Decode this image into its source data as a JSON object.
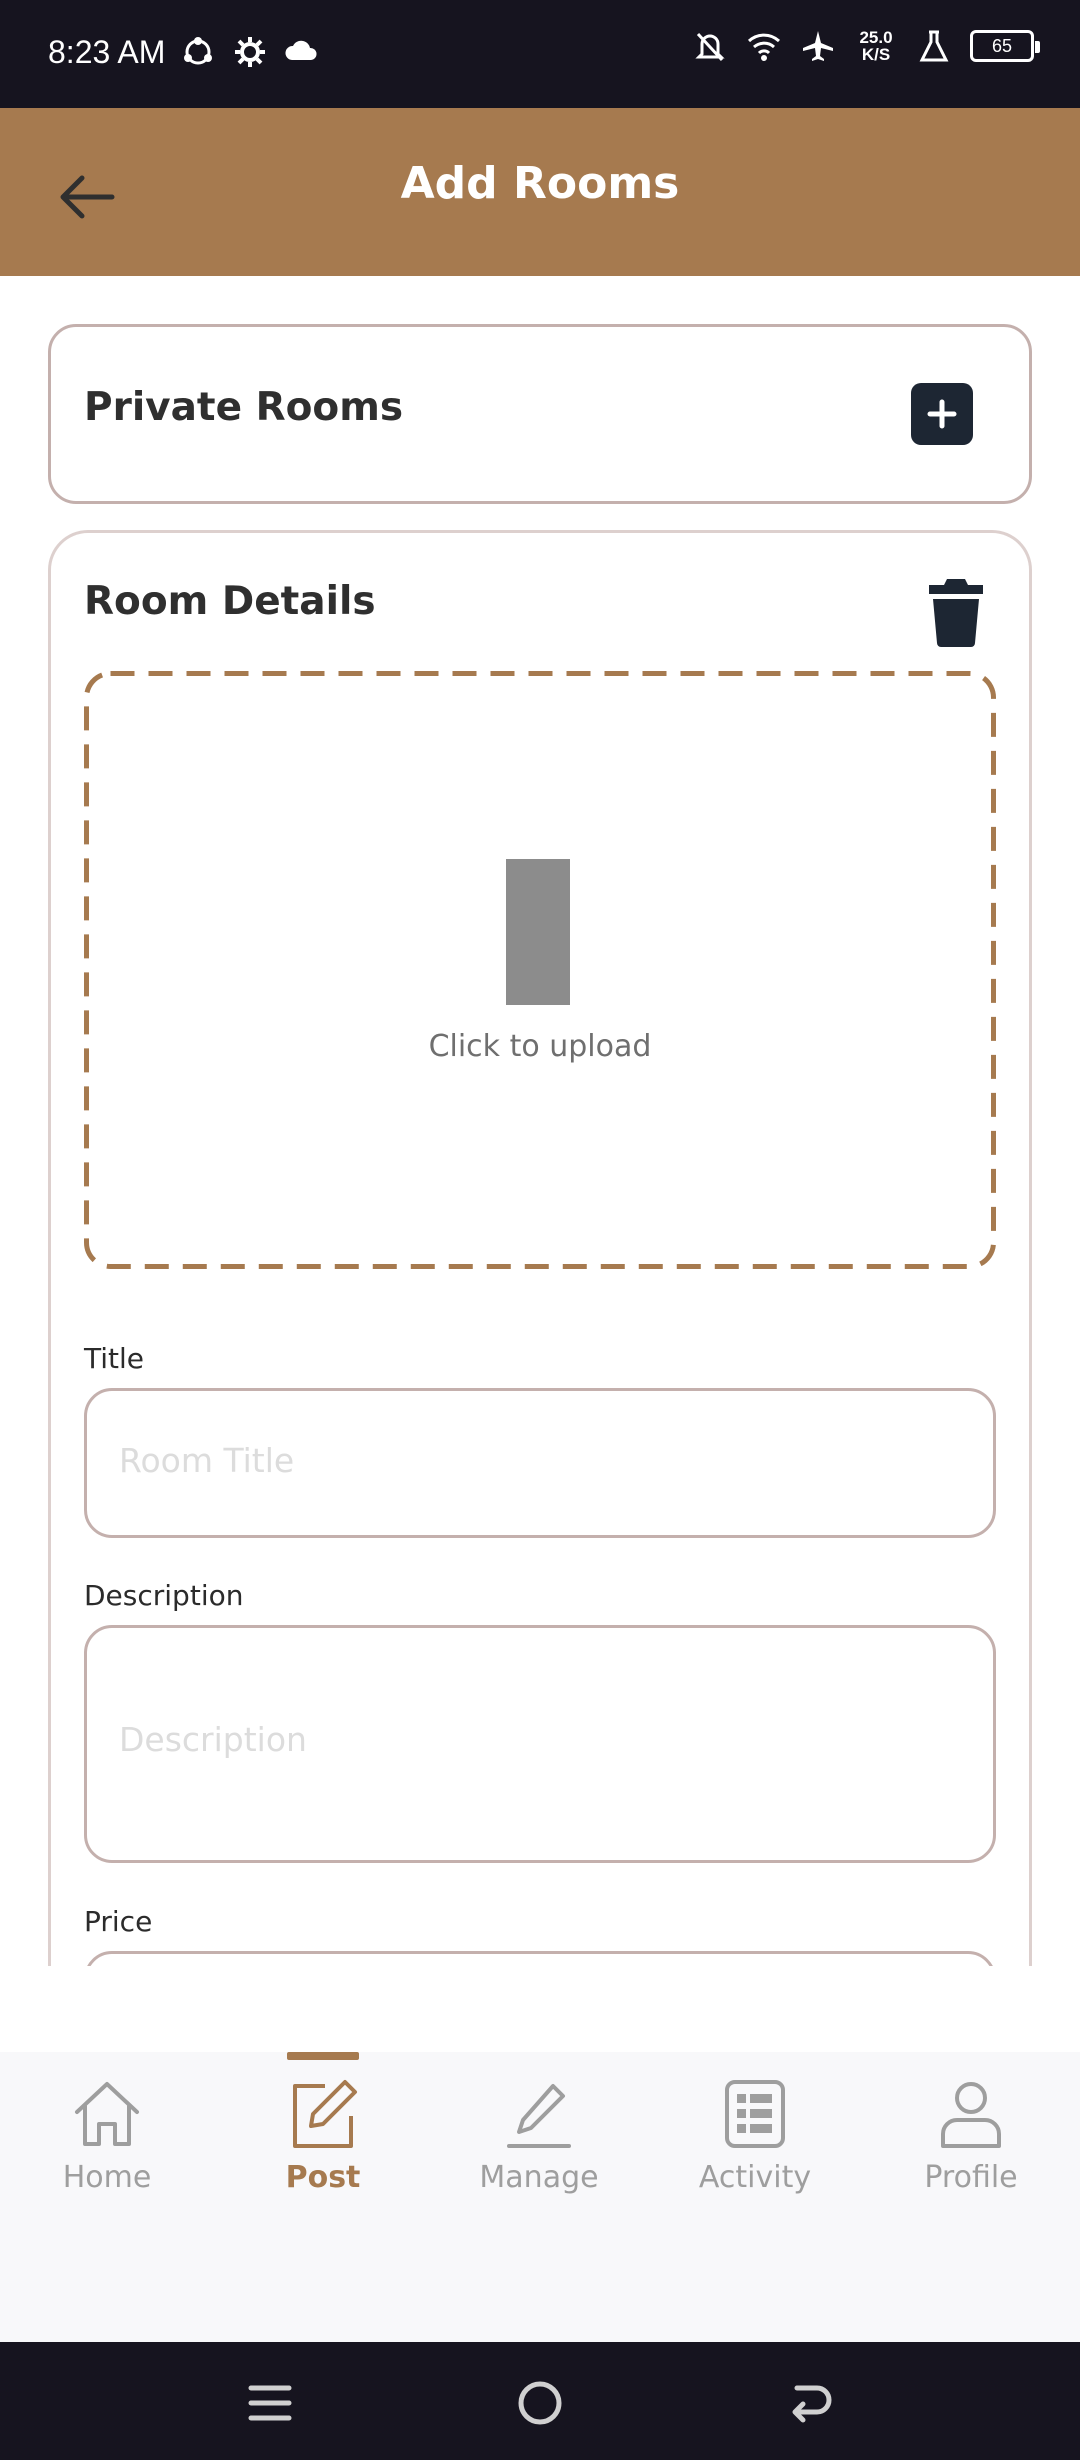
{
  "status_bar": {
    "time": "8:23 AM",
    "net_speed_value": "25.0",
    "net_speed_unit": "K/S",
    "battery": "65"
  },
  "header": {
    "title": "Add Rooms",
    "back_icon": "arrow-left-icon"
  },
  "private_rooms": {
    "title": "Private Rooms",
    "add_icon": "plus-icon"
  },
  "room_details": {
    "title": "Room Details",
    "delete_icon": "trash-icon",
    "upload_text": "Click to upload",
    "title_label": "Title",
    "title_placeholder": "Room Title",
    "title_value": "",
    "description_label": "Description",
    "description_placeholder": "Description",
    "description_value": "",
    "price_label": "Price"
  },
  "bottom_nav": {
    "items": [
      {
        "label": "Home",
        "icon": "home-icon"
      },
      {
        "label": "Post",
        "icon": "edit-square-icon",
        "active": true
      },
      {
        "label": "Manage",
        "icon": "pencil-icon"
      },
      {
        "label": "Activity",
        "icon": "list-icon"
      },
      {
        "label": "Profile",
        "icon": "user-icon"
      }
    ]
  },
  "colors": {
    "brand": "#a67a4f",
    "dark": "#1d2633",
    "border": "#c4b0ad"
  }
}
